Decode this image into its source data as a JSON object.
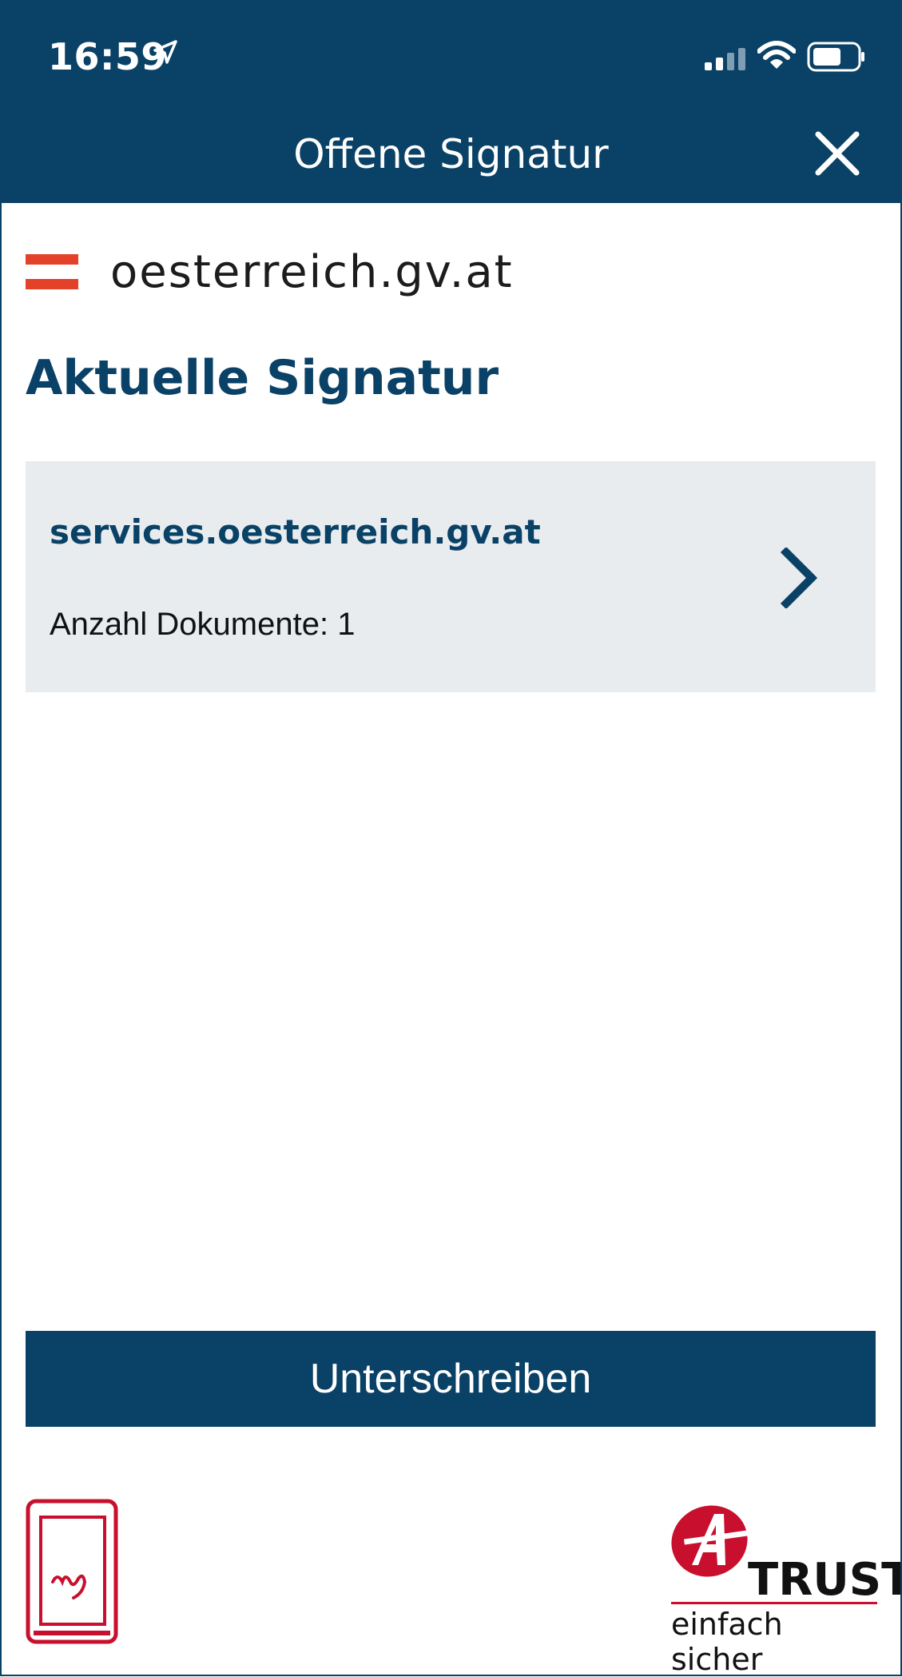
{
  "status_bar": {
    "time": "16:59"
  },
  "header": {
    "title": "Offene Signatur"
  },
  "brand": {
    "name": "oesterreich.gv.at"
  },
  "section": {
    "title": "Aktuelle Signatur"
  },
  "signature_card": {
    "host": "services.oesterreich.gv.at",
    "document_count": "Anzahl Dokumente: 1"
  },
  "actions": {
    "sign_label": "Unterschreiben"
  },
  "footer": {
    "atrust_word": "TRUST",
    "atrust_tagline": "einfach sicher"
  },
  "colors": {
    "primary": "#0a4166",
    "card_bg": "#e8ecef",
    "accent_red": "#c8102e",
    "flag_red": "#e4412a"
  }
}
